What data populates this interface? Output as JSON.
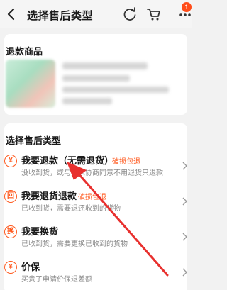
{
  "header": {
    "title": "选择售后类型",
    "cart_badge": "1"
  },
  "refund_goods": {
    "section_title": "退款商品"
  },
  "after_sale": {
    "section_title": "选择售后类型",
    "options": [
      {
        "icon_glyph": "¥",
        "icon": "yen-circle-icon",
        "title": "我要退款（无需退货）",
        "tag": "破损包退",
        "desc": "没收到货，或与卖家协商同意不用退货只退款"
      },
      {
        "icon_glyph": "回",
        "icon": "return-box-icon",
        "title": "我要退货退款",
        "tag": "破损包退",
        "desc": "已收到货，需要退还收到的货物"
      },
      {
        "icon_glyph": "换",
        "icon": "exchange-icon",
        "title": "我要换货",
        "tag": "",
        "desc": "已收到货，需要更换已收到的货物"
      },
      {
        "icon_glyph": "¥",
        "icon": "price-protect-icon",
        "title": "价保",
        "tag": "",
        "desc": "买贵了申请价保退差额"
      }
    ]
  },
  "colors": {
    "accent": "#ff5a1f",
    "annotation_arrow": "#e8302e"
  }
}
